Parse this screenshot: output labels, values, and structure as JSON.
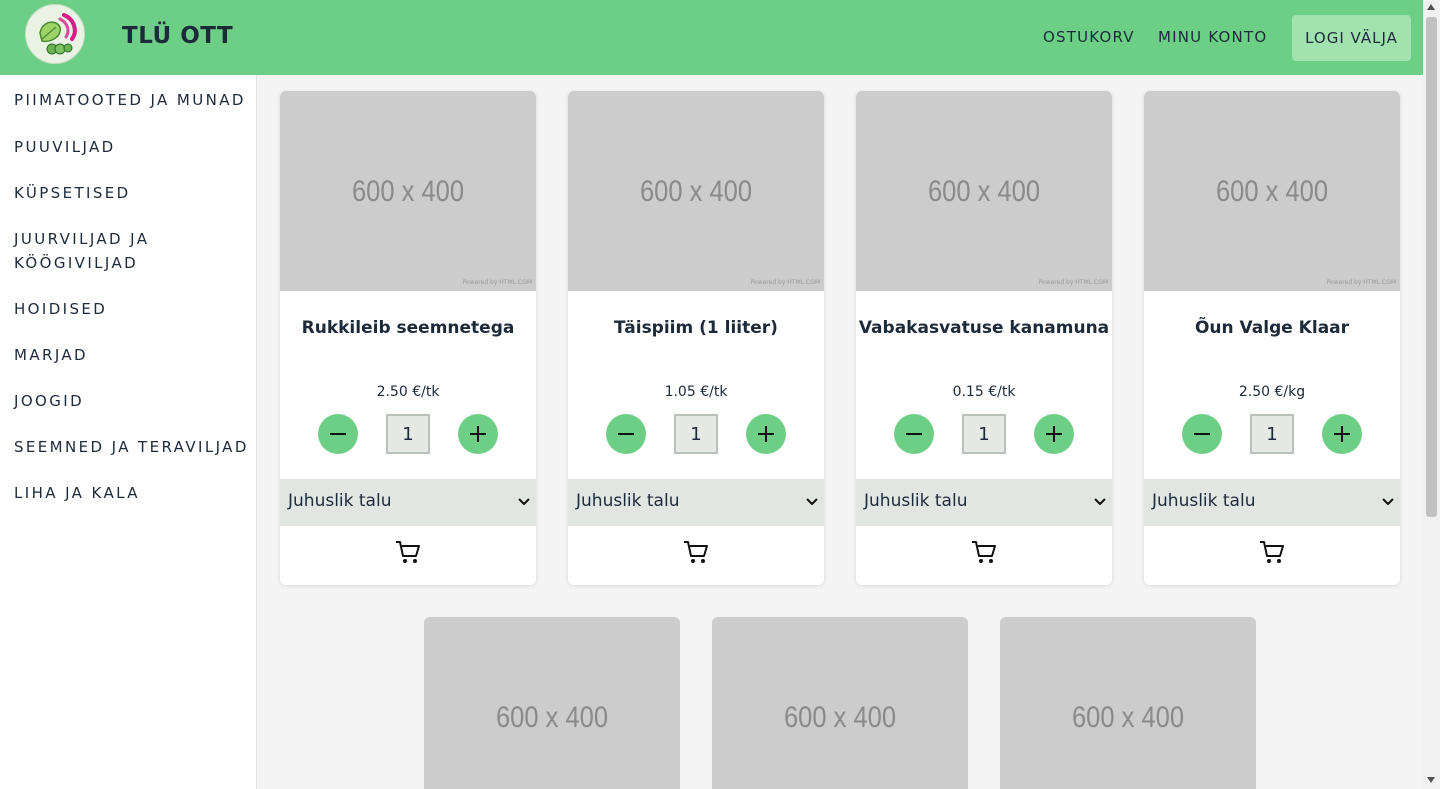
{
  "header": {
    "brand": "TLÜ OTT",
    "nav": {
      "cart": "OSTUKORV",
      "account": "MINU KONTO",
      "logout": "LOGI VÄLJA"
    }
  },
  "sidebar": {
    "categories": [
      "PIIMATOOTED JA MUNAD",
      "PUUVILJAD",
      "KÜPSETISED",
      "JUURVILJAD JA KÖÖGIVILJAD",
      "HOIDISED",
      "MARJAD",
      "JOOGID",
      "SEEMNED JA TERAVILJAD",
      "LIHA JA KALA"
    ]
  },
  "products": [
    {
      "name": "Rukkileib seemnetega",
      "price": "2.50 €/tk",
      "quantity": "1",
      "farm": "Juhuslik talu",
      "image_label": "600 x 400",
      "image_credit": "Powered by HTML.COM"
    },
    {
      "name": "Täispiim (1 liiter)",
      "price": "1.05 €/tk",
      "quantity": "1",
      "farm": "Juhuslik talu",
      "image_label": "600 x 400",
      "image_credit": "Powered by HTML.COM"
    },
    {
      "name": "Vabakasvatuse kanamuna",
      "price": "0.15 €/tk",
      "quantity": "1",
      "farm": "Juhuslik talu",
      "image_label": "600 x 400",
      "image_credit": "Powered by HTML.COM"
    },
    {
      "name": "Õun Valge Klaar",
      "price": "2.50 €/kg",
      "quantity": "1",
      "farm": "Juhuslik talu",
      "image_label": "600 x 400",
      "image_credit": "Powered by HTML.COM"
    }
  ],
  "partial_products": [
    {
      "image_label": "600 x 400"
    },
    {
      "image_label": "600 x 400"
    },
    {
      "image_label": "600 x 400"
    }
  ],
  "colors": {
    "accent": "#6dcf85",
    "logout_bg": "#a2e2af",
    "placeholder": "#cccccc"
  }
}
